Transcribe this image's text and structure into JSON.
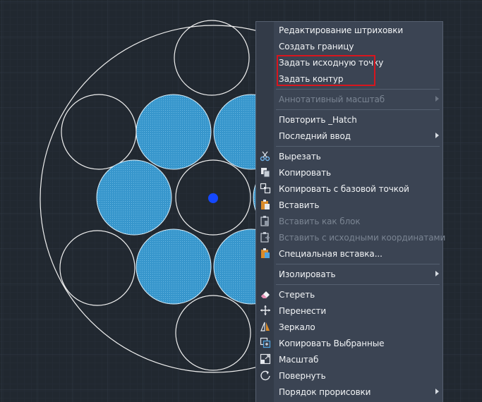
{
  "colors": {
    "background": "#212830",
    "grid": "#2c343f",
    "circle_stroke": "#f5f5f5",
    "hatch_fill": "#3a9ad0",
    "point": "#1448ff",
    "highlight": "#d8151d"
  },
  "menu": {
    "items": [
      {
        "label": "Редактирование штриховки",
        "icon": null,
        "disabled": false,
        "submenu": false
      },
      {
        "label": "Создать границу",
        "icon": null,
        "disabled": false,
        "submenu": false
      },
      {
        "label": "Задать исходную точку",
        "icon": null,
        "disabled": false,
        "submenu": false
      },
      {
        "label": "Задать контур",
        "icon": null,
        "disabled": false,
        "submenu": false
      },
      {
        "label": "Аннотативный масштаб",
        "icon": null,
        "disabled": true,
        "submenu": true
      },
      {
        "label": "Повторить _Hatch",
        "icon": null,
        "disabled": false,
        "submenu": false
      },
      {
        "label": "Последний ввод",
        "icon": null,
        "disabled": false,
        "submenu": true
      },
      {
        "label": "Вырезать",
        "icon": "scissors-icon",
        "disabled": false,
        "submenu": false
      },
      {
        "label": "Копировать",
        "icon": "copy-icon",
        "disabled": false,
        "submenu": false
      },
      {
        "label": "Копировать с базовой точкой",
        "icon": "copy-basepoint-icon",
        "disabled": false,
        "submenu": false
      },
      {
        "label": "Вставить",
        "icon": "paste-icon",
        "disabled": false,
        "submenu": false
      },
      {
        "label": "Вставить как блок",
        "icon": "paste-block-icon",
        "disabled": true,
        "submenu": false
      },
      {
        "label": "Вставить с исходными координатами",
        "icon": "paste-coords-icon",
        "disabled": true,
        "submenu": false
      },
      {
        "label": "Специальная вставка...",
        "icon": "paste-special-icon",
        "disabled": false,
        "submenu": false
      },
      {
        "label": "Изолировать",
        "icon": null,
        "disabled": false,
        "submenu": true
      },
      {
        "label": "Стереть",
        "icon": "eraser-icon",
        "disabled": false,
        "submenu": false
      },
      {
        "label": "Перенести",
        "icon": "move-icon",
        "disabled": false,
        "submenu": false
      },
      {
        "label": "Зеркало",
        "icon": "mirror-icon",
        "disabled": false,
        "submenu": false
      },
      {
        "label": "Копировать Выбранные",
        "icon": "copy-selected-icon",
        "disabled": false,
        "submenu": false
      },
      {
        "label": "Масштаб",
        "icon": "scale-icon",
        "disabled": false,
        "submenu": false
      },
      {
        "label": "Повернуть",
        "icon": "rotate-icon",
        "disabled": false,
        "submenu": false
      },
      {
        "label": "Порядок прорисовки",
        "icon": null,
        "disabled": false,
        "submenu": true
      }
    ]
  }
}
